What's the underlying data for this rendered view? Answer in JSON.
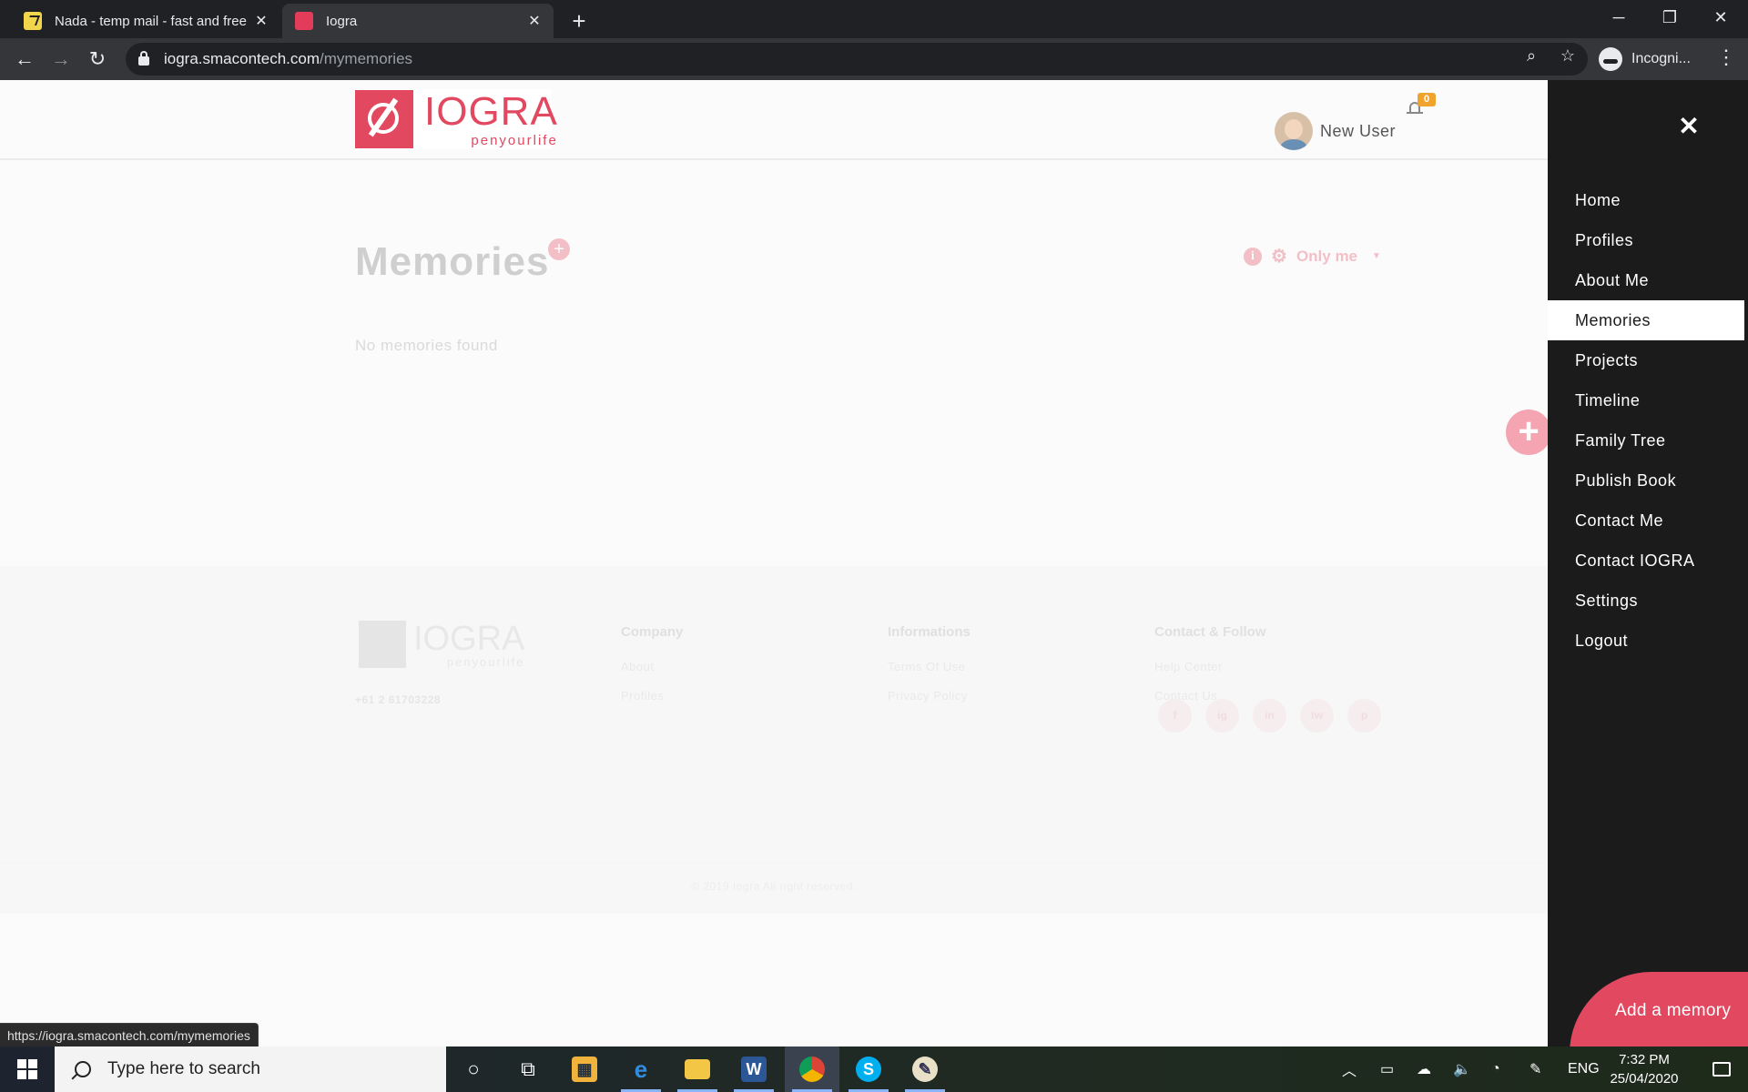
{
  "browser": {
    "tabs": [
      {
        "title": "Nada - temp mail - fast and free",
        "active": false
      },
      {
        "title": "Iogra",
        "active": true
      }
    ],
    "url_host": "iogra.smacontech.com",
    "url_path": "/mymemories",
    "profile_label": "Incogni...",
    "status_url": "https://iogra.smacontech.com/mymemories"
  },
  "header": {
    "logo_name": "IOGRA",
    "logo_tagline": "penyourlife",
    "user_name": "New User",
    "notification_count": "0"
  },
  "main": {
    "title": "Memories",
    "privacy_label": "Only me",
    "empty_message": "No memories found"
  },
  "footer": {
    "logo_name": "IOGRA",
    "logo_tagline": "penyourlife",
    "phone": "+61 2 61703228",
    "columns": [
      {
        "heading": "Company",
        "links": [
          "About",
          "Profiles"
        ]
      },
      {
        "heading": "Informations",
        "links": [
          "Terms Of Use",
          "Privacy Policy"
        ]
      },
      {
        "heading": "Contact & Follow",
        "links": [
          "Help Center",
          "Contact Us"
        ]
      }
    ],
    "socials": [
      "f",
      "ig",
      "in",
      "tw",
      "p"
    ],
    "copyright": "© 2019 Iogra All right reserved."
  },
  "side_menu": {
    "items": [
      {
        "label": "Home"
      },
      {
        "label": "Profiles"
      },
      {
        "label": "About Me"
      },
      {
        "label": "Memories",
        "active": true
      },
      {
        "label": "Projects"
      },
      {
        "label": "Timeline"
      },
      {
        "label": "Family Tree"
      },
      {
        "label": "Publish Book"
      },
      {
        "label": "Contact Me"
      },
      {
        "label": "Contact IOGRA"
      },
      {
        "label": "Settings"
      },
      {
        "label": "Logout"
      }
    ],
    "add_button_label": "Add a memory"
  },
  "taskbar": {
    "search_placeholder": "Type here to search",
    "language": "ENG",
    "time": "7:32 PM",
    "date": "25/04/2020"
  },
  "colors": {
    "brand": "#e2485f",
    "menu_bg": "#1b1b1b",
    "badge": "#f0a42e"
  }
}
